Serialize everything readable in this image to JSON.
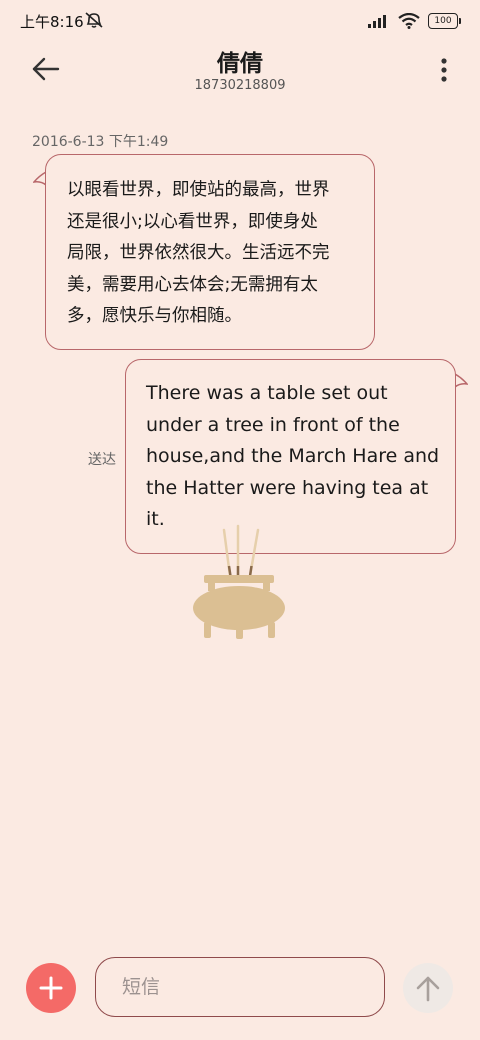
{
  "status_bar": {
    "time": "上午8:16",
    "battery": "100",
    "icons": [
      "mute-icon",
      "signal-icon",
      "wifi-icon",
      "battery-icon"
    ]
  },
  "header": {
    "contact_name": "倩倩",
    "contact_number": "18730218809",
    "icons": [
      "back-arrow-icon",
      "more-vertical-icon"
    ]
  },
  "conversation": {
    "timestamp": "2016-6-13 下午1:49",
    "messages": [
      {
        "direction": "incoming",
        "lines": [
          "以眼看世界，即使站的最高，世界",
          "还是很小;以心看世界，即使身处",
          "局限，世界依然很大。生活远不完",
          "美，需要用心去体会;无需拥有太",
          "多，愿快乐与你相随。"
        ]
      },
      {
        "direction": "outgoing",
        "status": "送达",
        "lines": [
          "There was a table set out",
          "under a tree in front of the",
          "house,and the March Hare and",
          "the Hatter were having tea at",
          "it."
        ]
      }
    ],
    "decoration": "incense-burner-icon"
  },
  "composer": {
    "placeholder": "短信",
    "value": "",
    "icons": [
      "plus-icon",
      "send-arrow-icon"
    ]
  },
  "colors": {
    "background": "#fbeae2",
    "bubble_border": "#b8676a",
    "add_button": "#f46a67",
    "send_button": "#efe9e5",
    "incense_burner": "#dbbf93"
  }
}
